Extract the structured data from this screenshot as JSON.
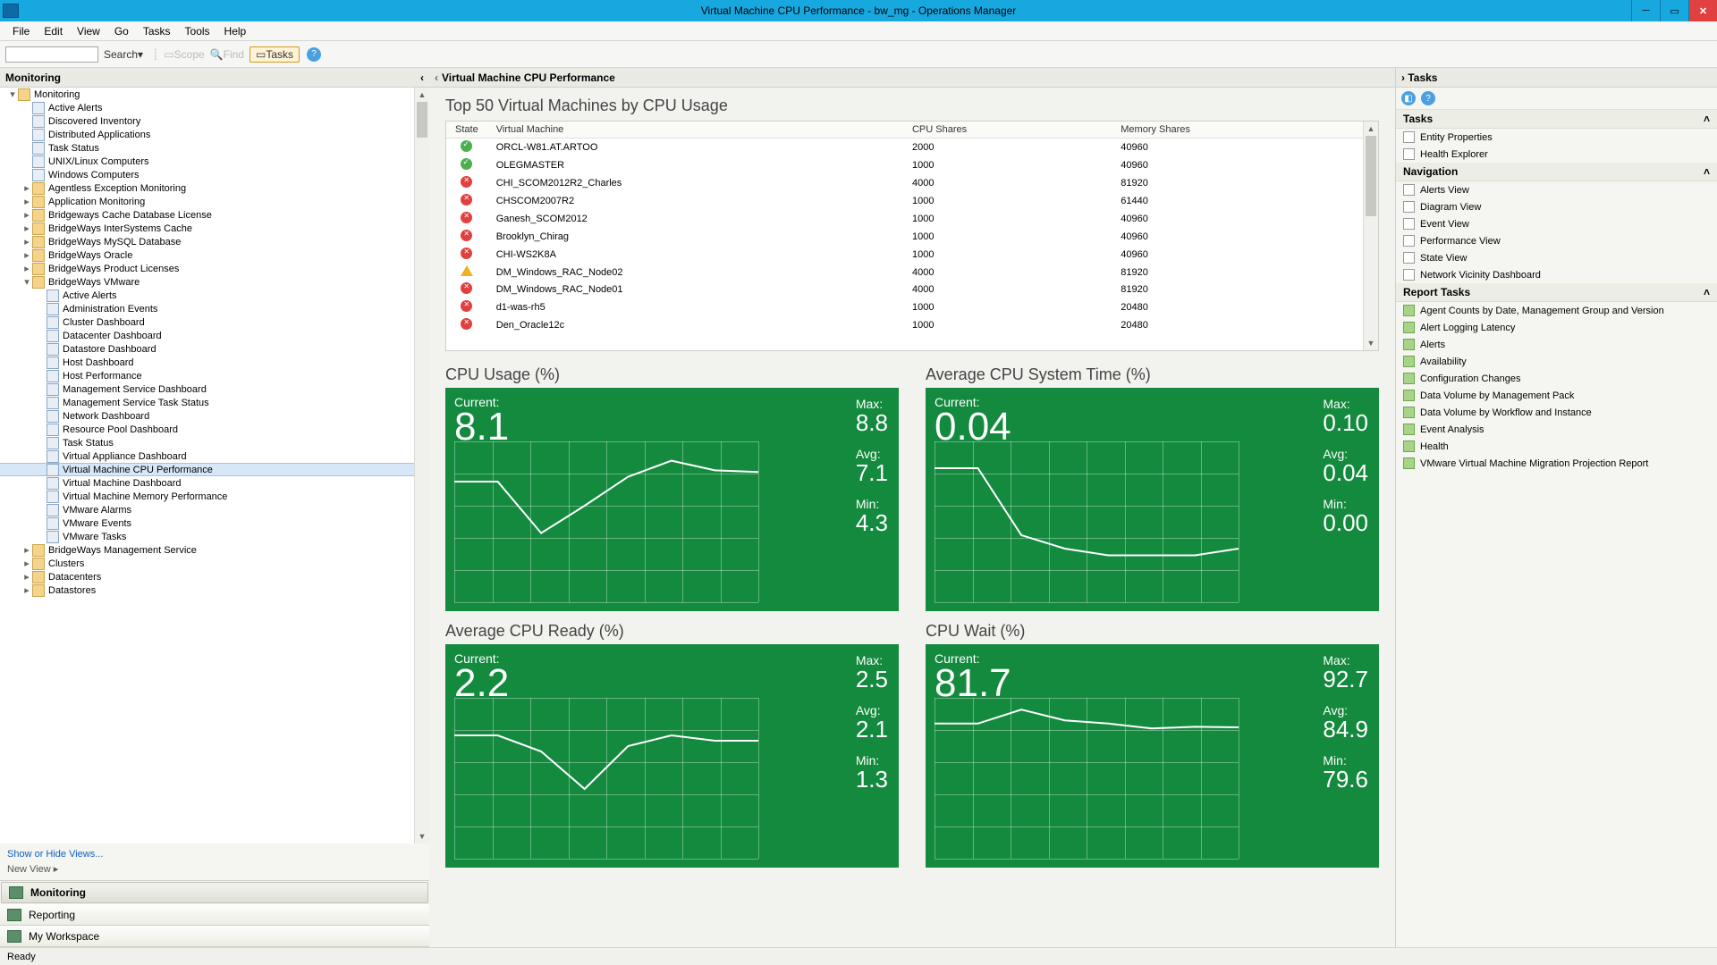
{
  "window": {
    "title": "Virtual Machine CPU Performance - bw_mg - Operations Manager"
  },
  "menu": [
    "File",
    "Edit",
    "View",
    "Go",
    "Tasks",
    "Tools",
    "Help"
  ],
  "toolbar": {
    "search": "Search",
    "scope": "Scope",
    "find": "Find",
    "tasks": "Tasks"
  },
  "nav": {
    "heading": "Monitoring",
    "tree": [
      {
        "d": 0,
        "arrow": "down",
        "ico": "folder",
        "label": "Monitoring"
      },
      {
        "d": 1,
        "ico": "view",
        "label": "Active Alerts"
      },
      {
        "d": 1,
        "ico": "view",
        "label": "Discovered Inventory"
      },
      {
        "d": 1,
        "ico": "view",
        "label": "Distributed Applications"
      },
      {
        "d": 1,
        "ico": "view",
        "label": "Task Status"
      },
      {
        "d": 1,
        "ico": "view",
        "label": "UNIX/Linux Computers"
      },
      {
        "d": 1,
        "ico": "view",
        "label": "Windows Computers"
      },
      {
        "d": 1,
        "arrow": "right",
        "ico": "folder",
        "label": "Agentless Exception Monitoring"
      },
      {
        "d": 1,
        "arrow": "right",
        "ico": "folder",
        "label": "Application Monitoring"
      },
      {
        "d": 1,
        "arrow": "right",
        "ico": "folder",
        "label": "Bridgeways Cache Database License"
      },
      {
        "d": 1,
        "arrow": "right",
        "ico": "folder",
        "label": "BridgeWays InterSystems Cache"
      },
      {
        "d": 1,
        "arrow": "right",
        "ico": "folder",
        "label": "BridgeWays MySQL Database"
      },
      {
        "d": 1,
        "arrow": "right",
        "ico": "folder",
        "label": "BridgeWays Oracle"
      },
      {
        "d": 1,
        "arrow": "right",
        "ico": "folder",
        "label": "BridgeWays Product Licenses"
      },
      {
        "d": 1,
        "arrow": "down",
        "ico": "folder",
        "label": "BridgeWays VMware"
      },
      {
        "d": 2,
        "ico": "view",
        "label": "Active Alerts"
      },
      {
        "d": 2,
        "ico": "view",
        "label": "Administration Events"
      },
      {
        "d": 2,
        "ico": "view",
        "label": "Cluster Dashboard"
      },
      {
        "d": 2,
        "ico": "view",
        "label": "Datacenter Dashboard"
      },
      {
        "d": 2,
        "ico": "view",
        "label": "Datastore Dashboard"
      },
      {
        "d": 2,
        "ico": "view",
        "label": "Host Dashboard"
      },
      {
        "d": 2,
        "ico": "view",
        "label": "Host Performance"
      },
      {
        "d": 2,
        "ico": "view",
        "label": "Management Service Dashboard"
      },
      {
        "d": 2,
        "ico": "view",
        "label": "Management Service Task Status"
      },
      {
        "d": 2,
        "ico": "view",
        "label": "Network Dashboard"
      },
      {
        "d": 2,
        "ico": "view",
        "label": "Resource Pool Dashboard"
      },
      {
        "d": 2,
        "ico": "view",
        "label": "Task Status"
      },
      {
        "d": 2,
        "ico": "view",
        "label": "Virtual Appliance Dashboard"
      },
      {
        "d": 2,
        "ico": "view",
        "label": "Virtual Machine CPU Performance",
        "selected": true
      },
      {
        "d": 2,
        "ico": "view",
        "label": "Virtual Machine Dashboard"
      },
      {
        "d": 2,
        "ico": "view",
        "label": "Virtual Machine Memory Performance"
      },
      {
        "d": 2,
        "ico": "view",
        "label": "VMware Alarms"
      },
      {
        "d": 2,
        "ico": "view",
        "label": "VMware Events"
      },
      {
        "d": 2,
        "ico": "view",
        "label": "VMware Tasks"
      },
      {
        "d": 1,
        "arrow": "right",
        "ico": "folder",
        "label": "BridgeWays Management Service"
      },
      {
        "d": 1,
        "arrow": "right",
        "ico": "folder",
        "label": "Clusters"
      },
      {
        "d": 1,
        "arrow": "right",
        "ico": "folder",
        "label": "Datacenters"
      },
      {
        "d": 1,
        "arrow": "right",
        "ico": "folder",
        "label": "Datastores"
      }
    ],
    "link1": "Show or Hide Views...",
    "link2": "New View ▸",
    "ws": [
      "Monitoring",
      "Reporting",
      "My Workspace"
    ]
  },
  "center": {
    "header": "Virtual Machine CPU Performance",
    "top_title": "Top 50 Virtual Machines by CPU Usage",
    "cols": [
      "State",
      "Virtual Machine",
      "CPU Shares",
      "Memory Shares"
    ],
    "rows": [
      {
        "s": "ok",
        "vm": "ORCL-W81.AT.ARTOO",
        "c": "2000",
        "m": "40960"
      },
      {
        "s": "ok",
        "vm": "OLEGMASTER",
        "c": "1000",
        "m": "40960"
      },
      {
        "s": "err",
        "vm": "CHI_SCOM2012R2_Charles",
        "c": "4000",
        "m": "81920"
      },
      {
        "s": "err",
        "vm": "CHSCOM2007R2",
        "c": "1000",
        "m": "61440"
      },
      {
        "s": "err",
        "vm": "Ganesh_SCOM2012",
        "c": "1000",
        "m": "40960"
      },
      {
        "s": "err",
        "vm": "Brooklyn_Chirag",
        "c": "1000",
        "m": "40960"
      },
      {
        "s": "err",
        "vm": "CHI-WS2K8A",
        "c": "1000",
        "m": "40960"
      },
      {
        "s": "warn",
        "vm": "DM_Windows_RAC_Node02",
        "c": "4000",
        "m": "81920"
      },
      {
        "s": "err",
        "vm": "DM_Windows_RAC_Node01",
        "c": "4000",
        "m": "81920"
      },
      {
        "s": "err",
        "vm": "d1-was-rh5",
        "c": "1000",
        "m": "20480"
      },
      {
        "s": "err",
        "vm": "Den_Oracle12c",
        "c": "1000",
        "m": "20480"
      }
    ]
  },
  "chart_data": [
    {
      "type": "line",
      "title": "CPU Usage (%)",
      "current": "8.1",
      "max": "8.8",
      "avg": "7.1",
      "min": "4.3",
      "ylim": [
        0,
        10
      ],
      "x": [
        0,
        1,
        2,
        3,
        4,
        5,
        6,
        7
      ],
      "values": [
        7.5,
        7.5,
        4.3,
        6.0,
        7.8,
        8.8,
        8.2,
        8.1
      ]
    },
    {
      "type": "line",
      "title": "Average CPU System Time (%)",
      "current": "0.04",
      "max": "0.10",
      "avg": "0.04",
      "min": "0.00",
      "ylim": [
        0,
        0.12
      ],
      "x": [
        0,
        1,
        2,
        3,
        4,
        5,
        6,
        7
      ],
      "values": [
        0.1,
        0.1,
        0.05,
        0.04,
        0.035,
        0.035,
        0.035,
        0.04
      ]
    },
    {
      "type": "line",
      "title": "Average CPU Ready (%)",
      "current": "2.2",
      "max": "2.5",
      "avg": "2.1",
      "min": "1.3",
      "ylim": [
        0,
        3
      ],
      "x": [
        0,
        1,
        2,
        3,
        4,
        5,
        6,
        7
      ],
      "values": [
        2.3,
        2.3,
        2.0,
        1.3,
        2.1,
        2.3,
        2.2,
        2.2
      ]
    },
    {
      "type": "line",
      "title": "CPU Wait (%)",
      "current": "81.7",
      "max": "92.7",
      "avg": "84.9",
      "min": "79.6",
      "ylim": [
        0,
        100
      ],
      "x": [
        0,
        1,
        2,
        3,
        4,
        5,
        6,
        7
      ],
      "values": [
        84,
        84,
        92.7,
        86,
        84,
        81,
        82,
        81.7
      ]
    }
  ],
  "labels": {
    "current": "Current:",
    "max": "Max:",
    "avg": "Avg:",
    "min": "Min:"
  },
  "tasks": {
    "heading": "Tasks",
    "s1": "Tasks",
    "s1items": [
      "Entity Properties",
      "Health Explorer"
    ],
    "s2": "Navigation",
    "s2items": [
      "Alerts View",
      "Diagram View",
      "Event View",
      "Performance View",
      "State View",
      "Network Vicinity Dashboard"
    ],
    "s3": "Report Tasks",
    "s3items": [
      "Agent Counts by Date, Management Group and Version",
      "Alert Logging Latency",
      "Alerts",
      "Availability",
      "Configuration Changes",
      "Data Volume by Management Pack",
      "Data Volume by Workflow and Instance",
      "Event Analysis",
      "Health",
      "VMware Virtual Machine Migration Projection Report"
    ]
  },
  "status": "Ready"
}
